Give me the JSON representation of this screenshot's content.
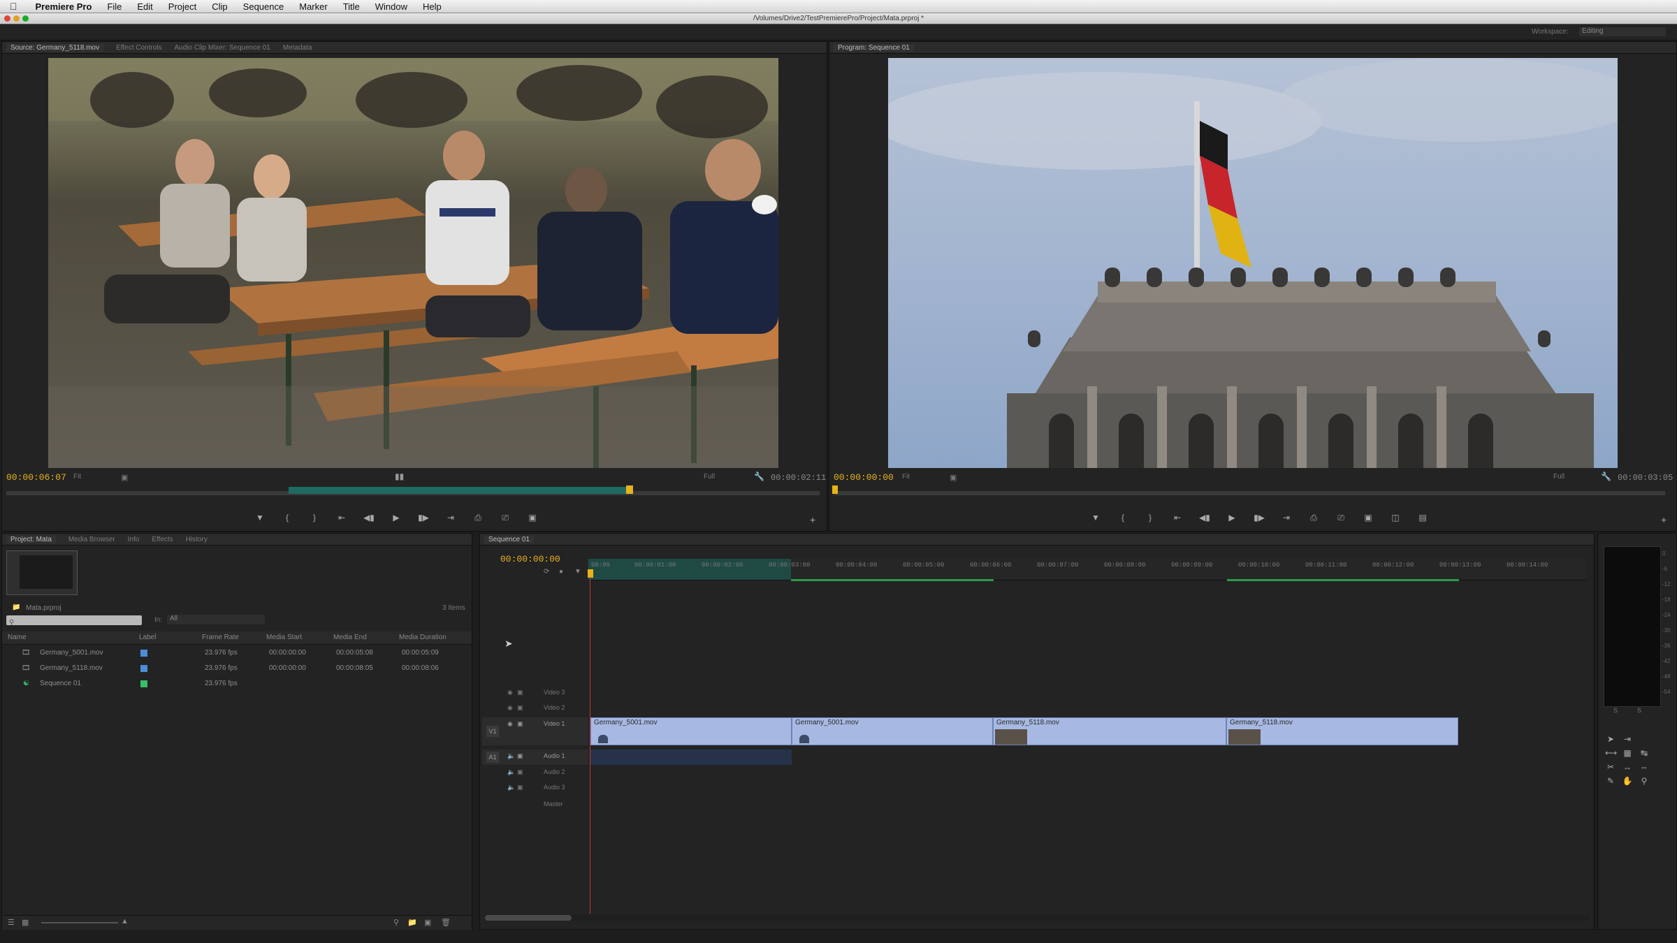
{
  "menubar": {
    "app_name": "Premiere Pro",
    "items": [
      "File",
      "Edit",
      "Project",
      "Clip",
      "Sequence",
      "Marker",
      "Title",
      "Window",
      "Help"
    ]
  },
  "window": {
    "title": "/Volumes/Drive2/TestPremierePro/Project/Mata.prproj *"
  },
  "workspace": {
    "label": "Workspace:",
    "value": "Editing"
  },
  "source_monitor": {
    "tabs": [
      "Source: Germany_5118.mov",
      "Effect Controls",
      "Audio Clip Mixer: Sequence 01",
      "Metadata"
    ],
    "timecode": "00:00:06:07",
    "zoom": "Fit",
    "resolution": "Full",
    "duration": "00:00:02:11"
  },
  "program_monitor": {
    "tab": "Program: Sequence 01",
    "timecode": "00:00:00:00",
    "zoom": "Fit",
    "resolution": "Full",
    "duration": "00:00:03:05"
  },
  "project_panel": {
    "tabs": [
      "Project: Mata",
      "Media Browser",
      "Info",
      "Effects",
      "History"
    ],
    "project_file": "Mata.prproj",
    "items_count": "3 Items",
    "search_in": "In:",
    "search_in_value": "All",
    "columns": [
      "Name",
      "Label",
      "Frame Rate",
      "Media Start",
      "Media End",
      "Media Duration"
    ],
    "rows": [
      {
        "name": "Germany_5001.mov",
        "label_color": "#4a8fd6",
        "frame_rate": "23.976 fps",
        "start": "00:00:00:00",
        "end": "00:00:05:08",
        "duration": "00:00:05:09"
      },
      {
        "name": "Germany_5118.mov",
        "label_color": "#4a8fd6",
        "frame_rate": "23.976 fps",
        "start": "00:00:00:00",
        "end": "00:00:08:05",
        "duration": "00:00:08:06"
      },
      {
        "name": "Sequence 01",
        "label_color": "#36c06a",
        "frame_rate": "23.976 fps",
        "start": "",
        "end": "",
        "duration": ""
      }
    ]
  },
  "timeline": {
    "tab": "Sequence 01",
    "timecode": "00:00:00:00",
    "ruler": [
      "00:00",
      "00:00:01:00",
      "00:00:02:00",
      "00:00:03:00",
      "00:00:04:00",
      "00:00:05:00",
      "00:00:06:00",
      "00:00:07:00",
      "00:00:08:00",
      "00:00:09:00",
      "00:00:10:00",
      "00:00:11:00",
      "00:00:12:00",
      "00:00:13:00",
      "00:00:14:00"
    ],
    "tracks": [
      "Video 3",
      "Video 2",
      "Video 1",
      "Audio 1",
      "Audio 2",
      "Audio 3",
      "Master"
    ],
    "source_patch": [
      "V1",
      "A1"
    ],
    "clips": [
      "Germany_5001.mov",
      "Germany_5001.mov",
      "Germany_5118.mov",
      "Germany_5118.mov"
    ]
  },
  "meter": {
    "scale": [
      "0",
      "-6",
      "-12",
      "-18",
      "-24",
      "-30",
      "-36",
      "-42",
      "-48",
      "-54"
    ]
  }
}
